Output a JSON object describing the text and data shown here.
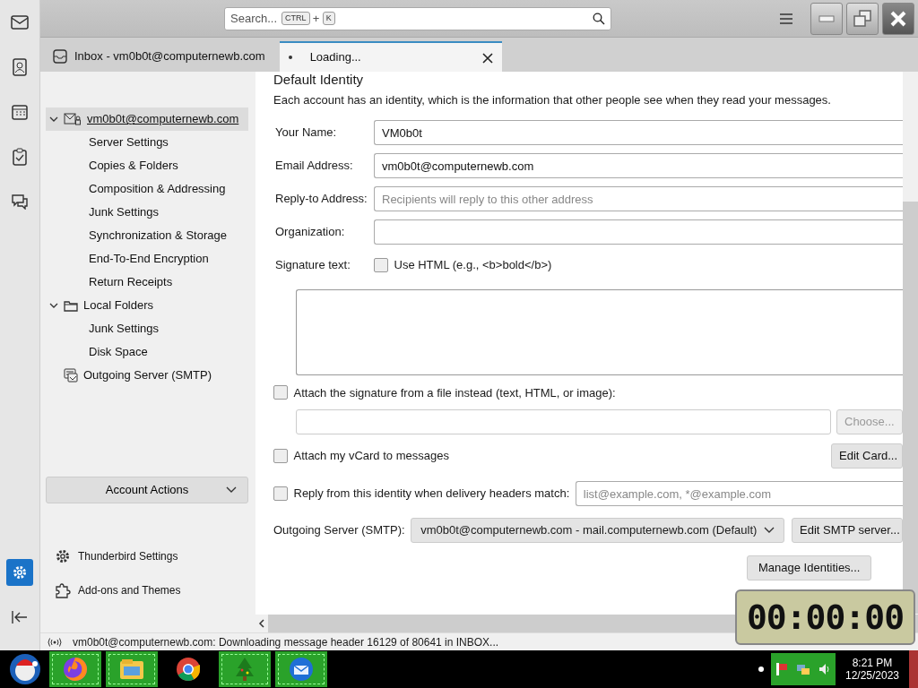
{
  "spaces_toolbar": [
    {
      "kind": "mail",
      "selected": false
    },
    {
      "kind": "address-book",
      "selected": false
    },
    {
      "kind": "calendar",
      "selected": false
    },
    {
      "kind": "tasks",
      "selected": false
    },
    {
      "kind": "chat",
      "selected": false
    },
    {
      "kind": "settings",
      "selected": true
    },
    {
      "kind": "collapse",
      "selected": false
    }
  ],
  "search": {
    "placeholder": "Search...",
    "keys": [
      "CTRL",
      "+",
      "K"
    ]
  },
  "tabs": [
    {
      "label": "Inbox - vm0b0t@computernewb.com",
      "selected": false,
      "loading": false
    },
    {
      "label": "Loading...",
      "selected": true,
      "loading": true
    }
  ],
  "account_tree": [
    {
      "label": "vm0b0t@computernewb.com",
      "kind": "account",
      "expanded": true,
      "selected": true,
      "children": [
        {
          "label": "Server Settings"
        },
        {
          "label": "Copies & Folders"
        },
        {
          "label": "Composition & Addressing"
        },
        {
          "label": "Junk Settings"
        },
        {
          "label": "Synchronization & Storage"
        },
        {
          "label": "End-To-End Encryption"
        },
        {
          "label": "Return Receipts"
        }
      ]
    },
    {
      "label": "Local Folders",
      "kind": "folder",
      "expanded": true,
      "selected": false,
      "children": [
        {
          "label": "Junk Settings"
        },
        {
          "label": "Disk Space"
        }
      ]
    },
    {
      "label": "Outgoing Server (SMTP)",
      "kind": "smtp",
      "selected": false
    }
  ],
  "account_actions": "Account Actions",
  "sidebar_footer": [
    {
      "label": "Thunderbird Settings",
      "kind": "gear"
    },
    {
      "label": "Add-ons and Themes",
      "kind": "puzzle"
    }
  ],
  "form": {
    "heading": "Default Identity",
    "description": "Each account has an identity, which is the information that other people see when they read your messages.",
    "fields": [
      {
        "label": "Your Name:",
        "value": "VM0b0t"
      },
      {
        "label": "Email Address:",
        "value": "vm0b0t@computernewb.com"
      },
      {
        "label": "Reply-to Address:",
        "placeholder": "Recipients will reply to this other address"
      },
      {
        "label": "Organization:"
      }
    ],
    "signature": {
      "label": "Signature text:",
      "html_option": "Use HTML (e.g., <b>bold</b>)",
      "checked": false
    },
    "attach_file": {
      "label": "Attach the signature from a file instead (text, HTML, or image):",
      "checked": false,
      "button": "Choose...",
      "button_disabled": true
    },
    "vcard": {
      "label": "Attach my vCard to messages",
      "checked": false,
      "button": "Edit Card..."
    },
    "reply_from": {
      "label": "Reply from this identity when delivery headers match:",
      "checked": false,
      "placeholder": "list@example.com, *@example.com"
    },
    "outgoing": {
      "label": "Outgoing Server (SMTP):",
      "value": "vm0b0t@computernewb.com - mail.computernewb.com (Default)",
      "button": "Edit SMTP server..."
    },
    "manage_button": "Manage Identities..."
  },
  "status_bar": {
    "text": "vm0b0t@computernewb.com: Downloading message header 16129 of 80641 in INBOX..."
  },
  "timer": {
    "display": "00:00:00"
  },
  "taskbar": {
    "apps": [
      {
        "kind": "firefox",
        "highlighted": true
      },
      {
        "kind": "explorer",
        "highlighted": true
      },
      {
        "kind": "chrome",
        "highlighted": false
      },
      {
        "kind": "tree",
        "highlighted": true
      },
      {
        "kind": "thunderbird",
        "highlighted": true
      }
    ],
    "time": "8:21 PM",
    "date": "12/25/2023"
  }
}
